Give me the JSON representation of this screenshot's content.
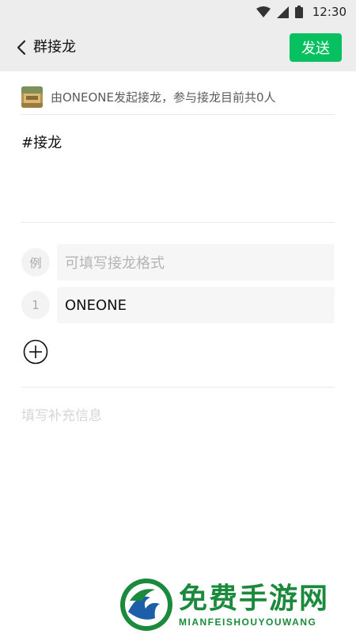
{
  "status_bar": {
    "time": "12:30",
    "icons": [
      "wifi-icon",
      "signal-icon",
      "battery-icon"
    ]
  },
  "header": {
    "title": "群接龙",
    "back_icon": "chevron-left-icon",
    "send_label": "发送"
  },
  "initiator": {
    "text": "由ONEONE发起接龙，参与接龙目前共0人"
  },
  "topic": "#接龙",
  "entries": [
    {
      "num": "例",
      "value": "",
      "placeholder": "可填写接龙格式"
    },
    {
      "num": "1",
      "value": "ONEONE",
      "placeholder": ""
    }
  ],
  "add_icon": "plus-circle-icon",
  "supplement_placeholder": "填写补充信息",
  "watermark": {
    "cn": "免费手游网",
    "en": "MIANFEISHOUYOUWANG"
  },
  "colors": {
    "accent": "#07c160",
    "header_bg": "#ededed",
    "watermark": "#1b8a3c"
  }
}
